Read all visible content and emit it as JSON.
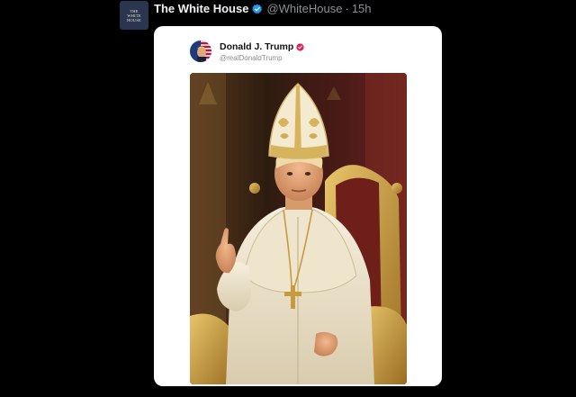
{
  "post": {
    "author_name": "The White House",
    "author_handle": "@WhiteHouse",
    "separator": "·",
    "timestamp": "15h",
    "avatar_text": [
      "THE",
      "WHITE",
      "HOUSE"
    ]
  },
  "quoted": {
    "author_name": "Donald J. Trump",
    "author_handle": "@realDonaldTrump"
  },
  "colors": {
    "verified_badge": "#1d9bf0",
    "quoted_badge": "#e0245e"
  },
  "icons": {
    "verified": "verified-check-icon",
    "quoted_verified": "verified-badge-icon"
  }
}
